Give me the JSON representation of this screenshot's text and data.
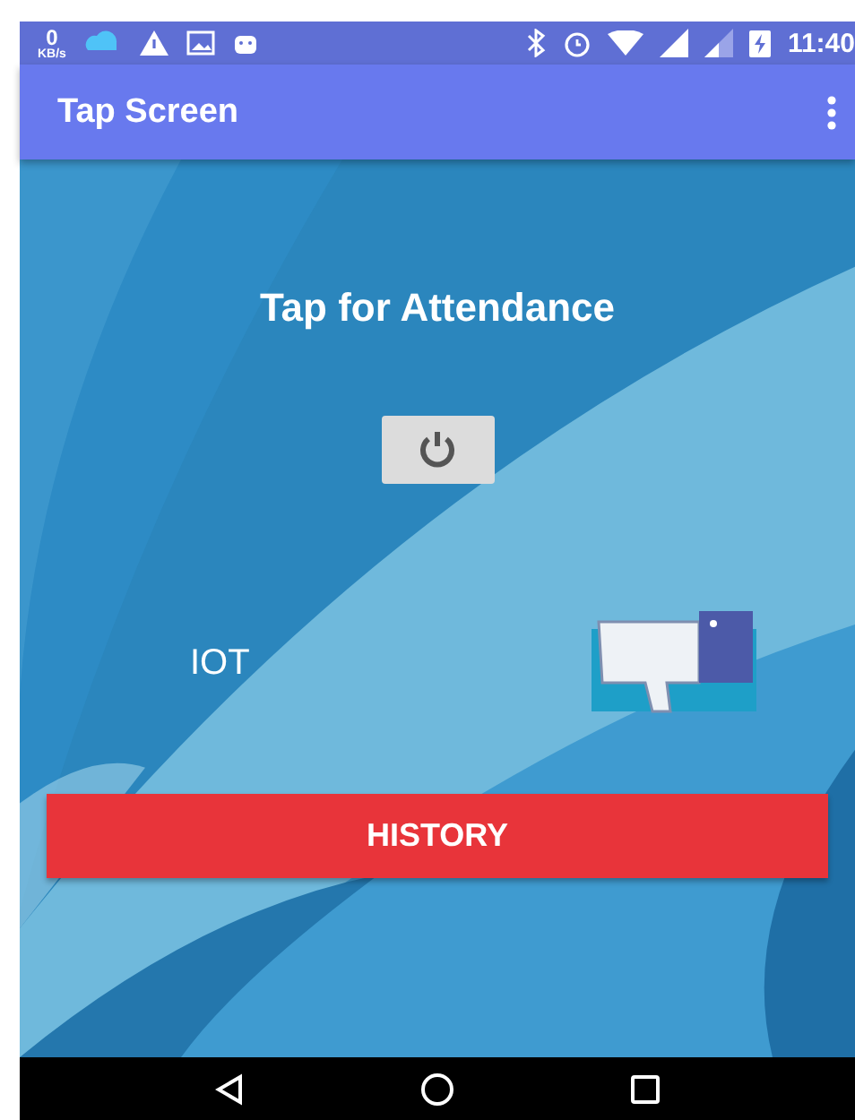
{
  "status_bar": {
    "speed_value": "0",
    "speed_unit": "KB/s",
    "time": "11:40"
  },
  "app_bar": {
    "title": "Tap Screen"
  },
  "heading": "Tap for Attendance",
  "device_label": "IOT",
  "history_button": "HISTORY"
}
